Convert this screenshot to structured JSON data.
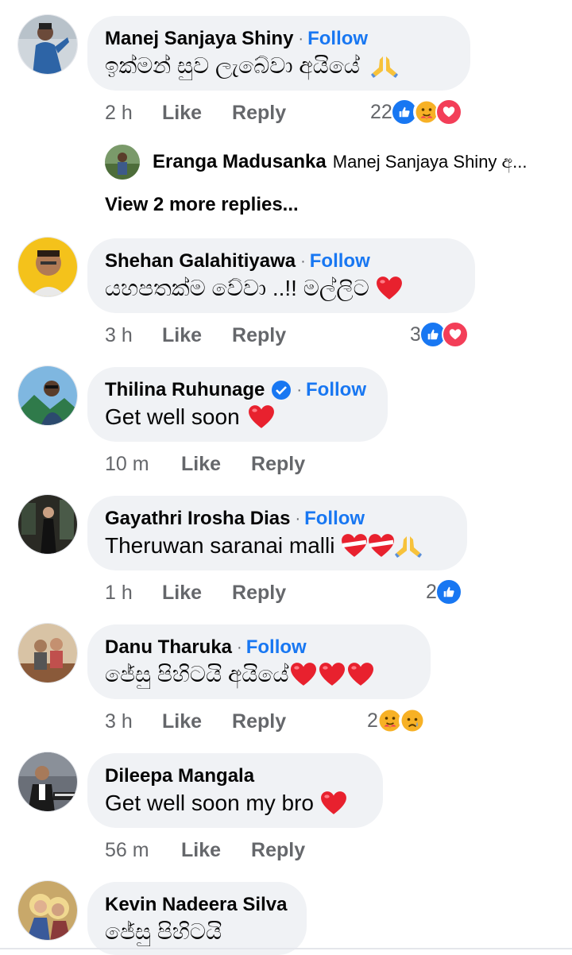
{
  "comments": [
    {
      "name": "Manej Sanjaya Shiny",
      "follow": "Follow",
      "text": "ඉක්මන් සුව ලැබේවා අයියේ",
      "emoji": "pray",
      "time": "2 h",
      "like": "Like",
      "reply": "Reply",
      "react_count": "22",
      "reactions": [
        "like",
        "care",
        "love"
      ],
      "avatar": "man-in-blue-suit"
    },
    {
      "name": "Shehan Galahitiyawa",
      "follow": "Follow",
      "text": "යහපතක්ම වේවා ..!! මල්ලිට",
      "emoji": "heart",
      "time": "3 h",
      "like": "Like",
      "reply": "Reply",
      "react_count": "3",
      "reactions": [
        "like",
        "love"
      ],
      "avatar": "smiling-man-yellow"
    },
    {
      "name": "Thilina Ruhunage",
      "follow": "Follow",
      "text": "Get well soon",
      "emoji": "heart",
      "time": "10 m",
      "like": "Like",
      "reply": "Reply",
      "react_count": "",
      "reactions": [],
      "verified": true,
      "avatar": "man-mountains"
    },
    {
      "name": "Gayathri Irosha Dias",
      "follow": "Follow",
      "text": "Theruwan saranai malli",
      "emoji": "heart-ribbons-pray",
      "time": "1 h",
      "like": "Like",
      "reply": "Reply",
      "react_count": "2",
      "reactions": [
        "like"
      ],
      "avatar": "woman-dark-room"
    },
    {
      "name": "Danu Tharuka",
      "follow": "Follow",
      "text": "ජේසු පිහිටයි අයියේ",
      "emoji": "three-hearts",
      "time": "3 h",
      "like": "Like",
      "reply": "Reply",
      "react_count": "2",
      "reactions": [
        "care",
        "sad"
      ],
      "avatar": "couple-photo"
    },
    {
      "name": "Dileepa Mangala",
      "follow": "",
      "text": "Get well soon my bro",
      "emoji": "heart",
      "time": "56 m",
      "like": "Like",
      "reply": "Reply",
      "react_count": "",
      "reactions": [],
      "avatar": "man-keyboard"
    },
    {
      "name": "Kevin Nadeera Silva",
      "follow": "",
      "text": "ජේසු පිහිටයි",
      "emoji": "",
      "avatar": "religious-painting"
    }
  ],
  "reply_preview": {
    "name": "Eranga Madusanka",
    "text": "Manej Sanjaya Shiny අ...",
    "avatar": "man-in-field"
  },
  "view_more": "View 2 more replies...",
  "colors": {
    "follow": "#1877f2",
    "bubble": "#f0f2f5",
    "muted": "#65676b",
    "like": "#1877f2",
    "love": "#f33e58"
  }
}
